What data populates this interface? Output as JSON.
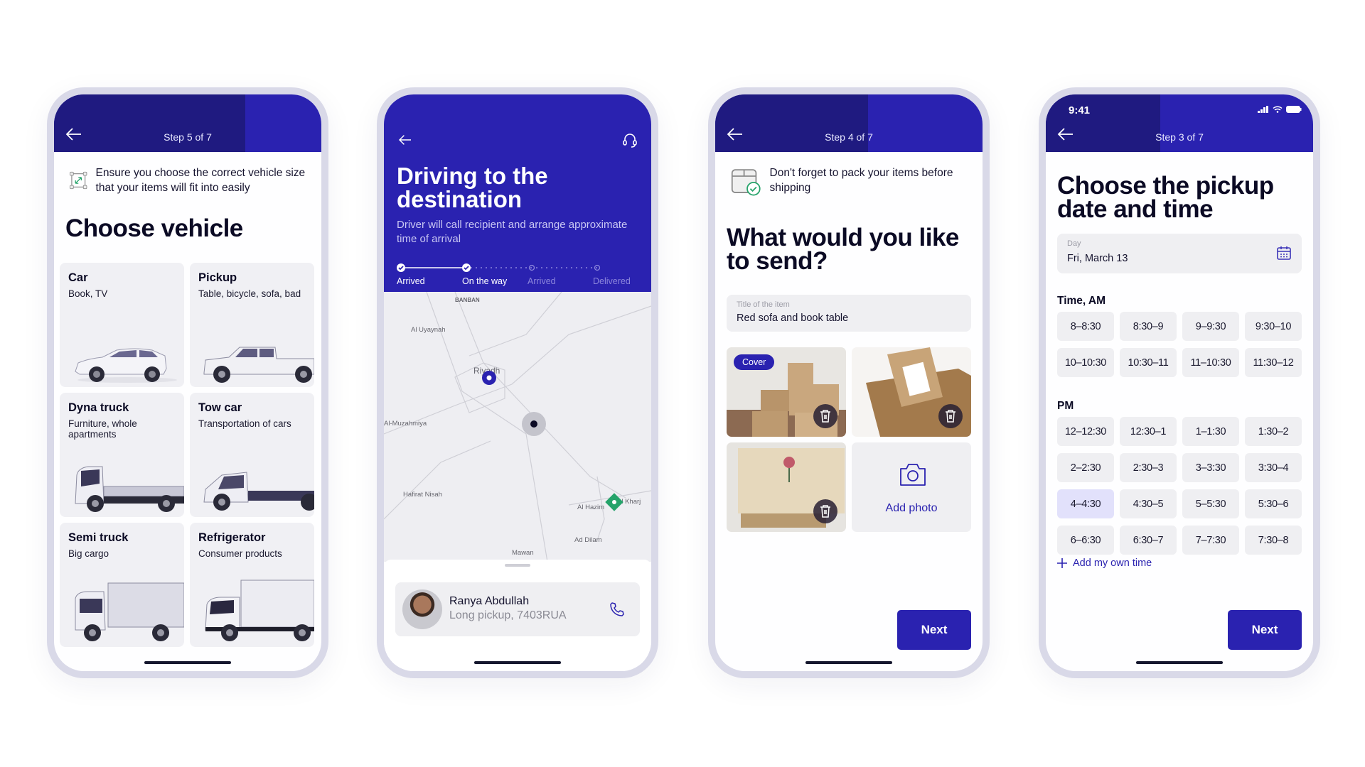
{
  "colors": {
    "primary": "#2a22b0",
    "primary_dark": "#1f1a80",
    "success": "#25a36a",
    "surface": "#efeff2"
  },
  "phone1": {
    "header": {
      "step_label": "Step 5 of 7",
      "step_current": 5,
      "step_total": 7,
      "back_icon": "arrow-left-icon"
    },
    "tip": {
      "icon": "resize-icon",
      "text": "Ensure you choose the correct vehicle size that your items will fit into easily"
    },
    "title": "Choose vehicle",
    "vehicles": [
      {
        "name": "Car",
        "desc": "Book, TV"
      },
      {
        "name": "Pickup",
        "desc": "Table, bicycle, sofa, bad"
      },
      {
        "name": "Dyna truck",
        "desc": "Furniture, whole apartments"
      },
      {
        "name": "Tow car",
        "desc": "Transportation of cars"
      },
      {
        "name": "Semi truck",
        "desc": "Big cargo"
      },
      {
        "name": "Refrigerator",
        "desc": "Consumer products"
      }
    ]
  },
  "phone2": {
    "back_icon": "arrow-left-icon",
    "support_icon": "headset-icon",
    "title": "Driving to the destination",
    "subtitle": "Driver will call recipient and arrange approximate time of arrival",
    "progress": [
      {
        "label": "Arrived",
        "done": true
      },
      {
        "label": "On the way",
        "done": true
      },
      {
        "label": "Arrived",
        "done": false
      },
      {
        "label": "Delivered",
        "done": false
      }
    ],
    "map_labels": [
      "BANBAN",
      "Al Uyaynah",
      "Riyadh",
      "Al-Muzahmiya",
      "Hafirat Nisah",
      "Al Hazim",
      "Al Kharj",
      "Ad Dilam",
      "Mawan"
    ],
    "driver": {
      "name": "Ranya Abdullah",
      "details": "Long pickup, 7403RUA",
      "call_icon": "phone-icon"
    }
  },
  "phone3": {
    "header": {
      "step_label": "Step 4 of 7",
      "step_current": 4,
      "step_total": 7
    },
    "tip": {
      "icon": "box-check-icon",
      "text": "Don't forget to pack your items before shipping"
    },
    "title": "What would you like to send?",
    "item_field": {
      "label": "Title of the item",
      "value": "Red sofa and book table"
    },
    "photos": [
      {
        "cover": true,
        "cover_label": "Cover"
      },
      {
        "cover": false
      },
      {
        "cover": false
      }
    ],
    "add_photo": "Add photo",
    "next": "Next"
  },
  "phone4": {
    "status": {
      "time": "9:41"
    },
    "header": {
      "step_label": "Step 3 of 7",
      "step_current": 3,
      "step_total": 7
    },
    "title": "Choose the pickup date and time",
    "day_field": {
      "label": "Day",
      "value": "Fri, March 13"
    },
    "am_label": "Time, AM",
    "am_slots": [
      "8–8:30",
      "8:30–9",
      "9–9:30",
      "9:30–10",
      "10–10:30",
      "10:30–11",
      "11–10:30",
      "11:30–12"
    ],
    "pm_label": "PM",
    "pm_slots": [
      "12–12:30",
      "12:30–1",
      "1–1:30",
      "1:30–2",
      "2–2:30",
      "2:30–3",
      "3–3:30",
      "3:30–4",
      "4–4:30",
      "4:30–5",
      "5–5:30",
      "5:30–6",
      "6–6:30",
      "6:30–7",
      "7–7:30",
      "7:30–8"
    ],
    "selected_slot": "4–4:30",
    "add_time": "Add my own time",
    "next": "Next"
  }
}
